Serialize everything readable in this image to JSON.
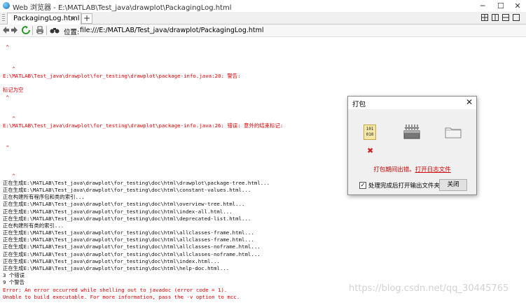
{
  "window": {
    "title": "Web 浏览器 - E:\\MATLAB\\Test_java\\drawplot\\PackagingLog.html",
    "controls": [
      "─",
      "☐",
      "✕"
    ]
  },
  "tabs": {
    "active_label": "PackagingLog.html",
    "close_glyph": "×",
    "add_glyph": "+"
  },
  "nav": {
    "address_label": "位置:",
    "address_value": "file:///E:/MATLAB/Test_java/drawplot/PackagingLog.html"
  },
  "log_lines": [
    {
      "text": "",
      "cls": "red"
    },
    {
      "text": " ^",
      "cls": "red"
    },
    {
      "text": "",
      "cls": "red"
    },
    {
      "text": "",
      "cls": "red"
    },
    {
      "text": "   ^",
      "cls": "red"
    },
    {
      "text": "E:\\MATLAB\\Test_java\\drawplot\\for_testing\\drawplot\\package-info.java:20: 警告:",
      "cls": "red"
    },
    {
      "text": "",
      "cls": "red"
    },
    {
      "text": "标记为空",
      "cls": "red"
    },
    {
      "text": " ^",
      "cls": "red"
    },
    {
      "text": "",
      "cls": "red"
    },
    {
      "text": "",
      "cls": "red"
    },
    {
      "text": "   ^",
      "cls": "red"
    },
    {
      "text": "E:\\MATLAB\\Test_java\\drawplot\\for_testing\\drawplot\\package-info.java:26: 错误: 意外的结束标记:",
      "cls": "red"
    },
    {
      "text": "",
      "cls": "red"
    },
    {
      "text": "",
      "cls": "red"
    },
    {
      "text": " \"",
      "cls": "red"
    },
    {
      "text": "",
      "cls": "red"
    },
    {
      "text": "",
      "cls": "red"
    },
    {
      "text": "",
      "cls": "red"
    },
    {
      "text": "   ^",
      "cls": "red"
    },
    {
      "text": "正在生成E:\\MATLAB\\Test_java\\drawplot\\for_testing\\doc\\html\\drawplot\\package-tree.html...",
      "cls": "blk"
    },
    {
      "text": "正在生成E:\\MATLAB\\Test_java\\drawplot\\for_testing\\doc\\html\\constant-values.html...",
      "cls": "blk"
    },
    {
      "text": "正在构建所有程序包和类的索引...",
      "cls": "blk"
    },
    {
      "text": "正在生成E:\\MATLAB\\Test_java\\drawplot\\for_testing\\doc\\html\\overview-tree.html...",
      "cls": "blk"
    },
    {
      "text": "正在生成E:\\MATLAB\\Test_java\\drawplot\\for_testing\\doc\\html\\index-all.html...",
      "cls": "blk"
    },
    {
      "text": "正在生成E:\\MATLAB\\Test_java\\drawplot\\for_testing\\doc\\html\\deprecated-list.html...",
      "cls": "blk"
    },
    {
      "text": "正在构建所有类的索引...",
      "cls": "blk"
    },
    {
      "text": "正在生成E:\\MATLAB\\Test_java\\drawplot\\for_testing\\doc\\html\\allclasses-frame.html...",
      "cls": "blk"
    },
    {
      "text": "正在生成E:\\MATLAB\\Test_java\\drawplot\\for_testing\\doc\\html\\allclasses-frame.html...",
      "cls": "blk"
    },
    {
      "text": "正在生成E:\\MATLAB\\Test_java\\drawplot\\for_testing\\doc\\html\\allclasses-noframe.html...",
      "cls": "blk"
    },
    {
      "text": "正在生成E:\\MATLAB\\Test_java\\drawplot\\for_testing\\doc\\html\\allclasses-noframe.html...",
      "cls": "blk"
    },
    {
      "text": "正在生成E:\\MATLAB\\Test_java\\drawplot\\for_testing\\doc\\html\\index.html...",
      "cls": "blk"
    },
    {
      "text": "正在生成E:\\MATLAB\\Test_java\\drawplot\\for_testing\\doc\\html\\help-doc.html...",
      "cls": "blk"
    },
    {
      "text": "3 个错误",
      "cls": "blk"
    },
    {
      "text": "9 个警告",
      "cls": "blk"
    },
    {
      "text": "Error: An error occurred while shelling out to javadoc (error code = 1).",
      "cls": "red"
    },
    {
      "text": "Unable to build executable. For more information, pass the -v option to mcc.",
      "cls": "red"
    }
  ],
  "watermark": "https://blog.csdn.net/qq_30445765",
  "dialog": {
    "title": "打包",
    "close_glyph": "✕",
    "bin_icon_text": "101\n010",
    "error_glyph": "✖",
    "message": "打包期间出错。",
    "link": "打开日志文件",
    "checkbox_checked": true,
    "checkbox_glyph": "✓",
    "checkbox_label": "处理完成后打开输出文件夹",
    "close_button": "关闭"
  },
  "colors": {
    "error_red": "#e00000",
    "log_black": "#111111",
    "dialog_bg": "#f0f0f0"
  }
}
